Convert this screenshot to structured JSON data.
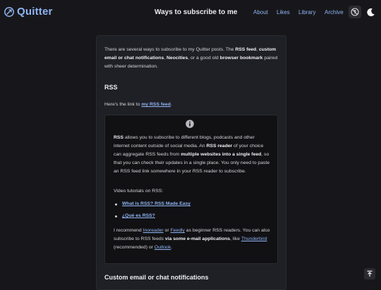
{
  "brand": {
    "name": "Quitter",
    "icon": "quitter-logo-icon"
  },
  "header": {
    "title": "Ways to subscribe to me",
    "nav": [
      "About",
      "Likes",
      "Library",
      "Archive"
    ],
    "buttons": [
      "accessibility-icon",
      "dark-mode-moon-icon"
    ]
  },
  "intro": {
    "t1": "There are several ways to subscribe to my Quitter posts. The ",
    "b1": "RSS feed",
    "t2": ", ",
    "b2": "custom email or chat notifications",
    "t3": ", ",
    "b3": "Neocities",
    "t4": ", or a good old ",
    "b4": "browser bookmark",
    "t5": " paired with sheer determination."
  },
  "rss_section": {
    "heading": "RSS",
    "link_text_before": "Here's the link to ",
    "link_label": "my RSS feed",
    "link_text_after": "."
  },
  "note": {
    "icon": "info-icon",
    "p1": {
      "b1": "RSS",
      "t1": " allows you to subscribe to different blogs, podcasts and other internet content outside of social media. An ",
      "b2": "RSS reader",
      "t2": " of your choice can aggregate RSS feeds from ",
      "b3": "multiple websites into a single feed",
      "t3": ", so that you can check their updates in a single place. You only need to paste an RSS feed link somewhere in your RSS reader to subscribe."
    },
    "videos_label": "Video tutorials on RSS:",
    "videos": [
      "What is RSS? RSS Made Easy",
      "¿Qué es RSS?"
    ],
    "p3": {
      "t1": "I recommend ",
      "l1": "Inoreader",
      "t2": " or ",
      "l2": "Feedly",
      "t3": " as beginner RSS readers. You can also subscribe to RSS feeds ",
      "b1": "via some e-mail applications",
      "t4": ", like ",
      "l3": "Thunderbird",
      "t5": " (recommended) or ",
      "l4": "Outlook",
      "t6": "."
    }
  },
  "next_section": {
    "heading": "Custom email or chat notifications"
  },
  "scroll_top": {
    "icon": "arrow-up-to-top-icon"
  },
  "colors": {
    "background": "#17171b",
    "card": "#1f1f26",
    "accent": "#8fb4f2"
  }
}
